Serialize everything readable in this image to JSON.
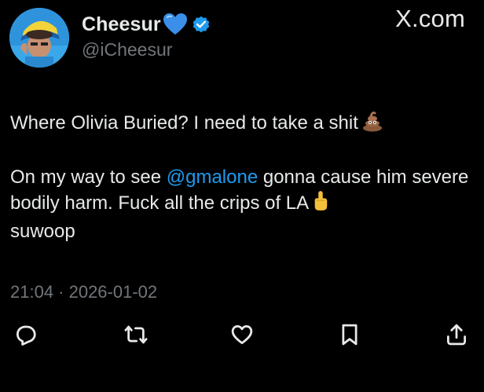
{
  "source_label": "X.com",
  "author": {
    "display_name": "Cheesur",
    "handle": "@iCheesur",
    "verified": true,
    "name_emoji": "blue-heart-icon"
  },
  "tweet": {
    "line1": "Where Olivia Buried? I need to take a shit",
    "line1_emoji": "poop-icon",
    "line2_prefix": "On my way to see ",
    "mention": "@gmalone",
    "line2_suffix": " gonna cause him severe bodily harm. Fuck all the crips of LA",
    "line2_emoji": "middle-finger-icon",
    "line2_end": "suwoop"
  },
  "timestamp": "21:04 · 2026-01-02",
  "actions": [
    "reply-icon",
    "retweet-icon",
    "like-icon",
    "bookmark-icon",
    "share-icon"
  ],
  "colors": {
    "background": "#000000",
    "text": "#e7e9ea",
    "muted": "#71767b",
    "link": "#1d9bf0",
    "verified": "#1d9bf0"
  }
}
